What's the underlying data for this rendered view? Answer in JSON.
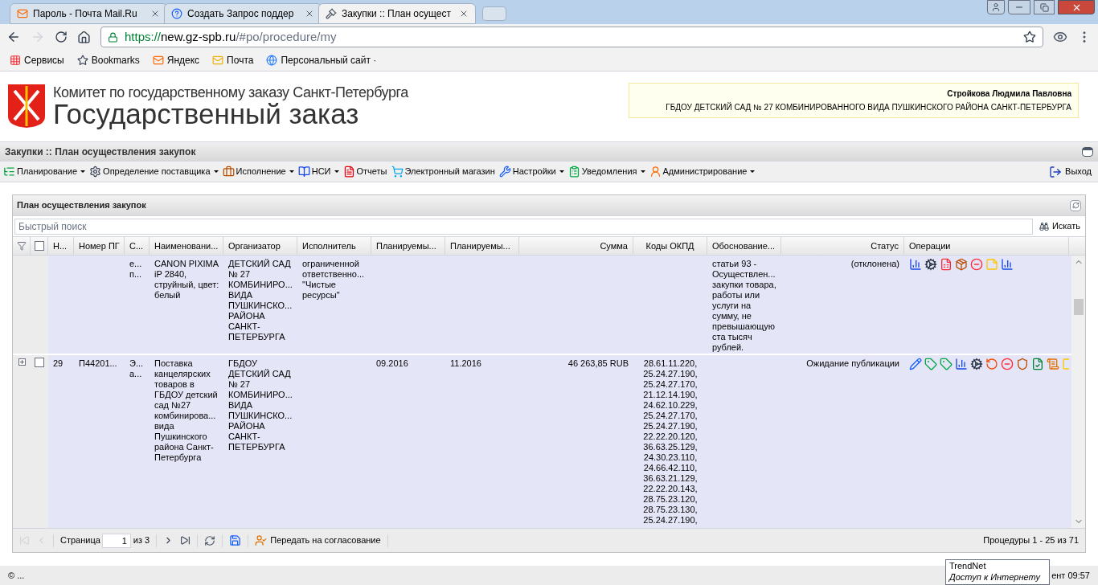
{
  "browser": {
    "tabs": [
      {
        "title": "Пароль - Почта Mail.Ru",
        "selected": false
      },
      {
        "title": "Создать Запрос поддер",
        "selected": false
      },
      {
        "title": "Закупки :: План осущест",
        "selected": true
      }
    ],
    "address_scheme": "https://",
    "address_host": "new.gz-spb.ru",
    "address_path": "/#po/procedure/my",
    "bookmarks": [
      "Сервисы",
      "Bookmarks",
      "Яндекс",
      "Почта",
      "Персональный сайт ·"
    ]
  },
  "header": {
    "title_small": "Комитет по государственному заказу Санкт-Петербурга",
    "title_large": "Государственный заказ",
    "user_name": "Стройкова Людмила Павловна",
    "user_org": "ГБДОУ ДЕТСКИЙ САД № 27 КОМБИНИРОВАННОГО ВИДА ПУШКИНСКОГО РАЙОНА САНКТ-ПЕТЕРБУРГА"
  },
  "module_title": "Закупки :: План осуществления закупок",
  "menu": [
    {
      "label": "Планирование",
      "dropdown": true
    },
    {
      "label": "Определение поставщика",
      "dropdown": true
    },
    {
      "label": "Исполнение",
      "dropdown": true
    },
    {
      "label": "НСИ",
      "dropdown": true
    },
    {
      "label": "Отчеты",
      "dropdown": false
    },
    {
      "label": "Электронный магазин",
      "dropdown": false
    },
    {
      "label": "Настройки",
      "dropdown": true
    },
    {
      "label": "Уведомления",
      "dropdown": true
    },
    {
      "label": "Администрирование",
      "dropdown": true
    }
  ],
  "exit": "Выход",
  "grid": {
    "title": "План осуществления закупок",
    "search_placeholder": "Быстрый поиск",
    "search_button": "Искать",
    "select_all_checked": false,
    "columns": [
      "Н...",
      "Номер ПГ",
      "С...",
      "Наименовани...",
      "Организатор",
      "Исполнитель",
      "Планируемы...",
      "Планируемы...",
      "Сумма",
      "Коды ОКПД",
      "Обоснование...",
      "Статус",
      "Операции"
    ],
    "rows": [
      {
        "number": "",
        "pg": "",
        "c": "е...\nп...",
        "name": "CANON PIXIMA\niP 2840,\nструйный, цвет:\nбелый",
        "organizer": "ДЕТСКИЙ САД\n№ 27\nКОМБИНИРО...\nВИДА\nПУШКИНСКО...\nРАЙОНА\nСАНКТ-\nПЕТЕРБУРГА",
        "executor": "ограниченной\nответственно...\n\"Чистые\nресурсы\"",
        "plan1": "",
        "plan2": "",
        "sum": "",
        "okpd": "",
        "basis": "статьи 93 -\nОсуществлен...\nзакупки товара,\nработы или\nуслуги на\nсумму, не\nпревышающую\nста тысяч\nрублей.",
        "status": "(отклонена)"
      },
      {
        "expanded": false,
        "checked": false,
        "number": "29",
        "pg": "П44201...",
        "c": "Э...\nа...",
        "name": "Поставка\nканцелярских\nтоваров в\nГБДОУ детский\nсад №27\nкомбинирова...\nвида\nПушкинского\nрайона Санкт-\nПетербурга",
        "organizer": "ГБДОУ\nДЕТСКИЙ САД\n№ 27\nКОМБИНИРО...\nВИДА\nПУШКИНСКО...\nРАЙОНА\nСАНКТ-\nПЕТЕРБУРГА",
        "executor": "",
        "plan1": "09.2016",
        "plan2": "11.2016",
        "sum": "46 263,85 RUB",
        "okpd": "28.61.11.220,\n25.24.27.190,\n25.24.27.170,\n21.12.14.190,\n24.62.10.229,\n25.24.27.170,\n25.24.27.190,\n22.22.20.120,\n36.63.25.129,\n24.30.23.110,\n24.66.42.110,\n36.63.21.129,\n22.22.20.143,\n28.75.23.120,\n28.75.23.130,\n25.24.27.190,",
        "basis": "",
        "status": "Ожидание публикации"
      }
    ],
    "pager": {
      "page_label": "Страница",
      "page": "1",
      "of": "из 3",
      "send": "Передать на согласование",
      "summary": "Процедуры 1 - 25 из 71"
    }
  },
  "status_bar": {
    "left": "© ...",
    "right": "ент 09:57"
  },
  "tooltip": {
    "title": "TrendNet",
    "text": "Доступ к Интернету"
  }
}
